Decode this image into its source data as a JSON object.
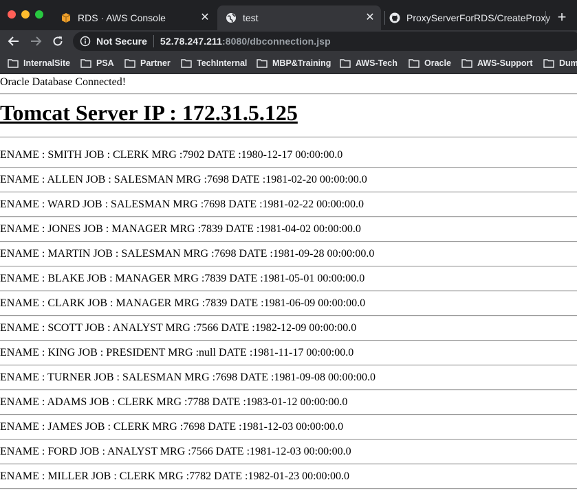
{
  "browser": {
    "tabs": [
      {
        "title": "RDS · AWS Console",
        "icon": "aws-box-icon",
        "active": false
      },
      {
        "title": "test",
        "icon": "globe-icon",
        "active": true
      },
      {
        "title": "ProxyServerForRDS/CreateProxy",
        "icon": "github-icon",
        "active": false
      }
    ],
    "security_label": "Not Secure",
    "url_host": "52.78.247.211",
    "url_rest": ":8080/dbconnection.jsp",
    "bookmarks": [
      "InternalSite",
      "PSA",
      "Partner",
      "TechInternal",
      "MBP&Training",
      "AWS-Tech",
      "Oracle",
      "AWS-Support",
      "Dum"
    ]
  },
  "page": {
    "status_text": "Oracle Database Connected!",
    "server_heading": "Tomcat Server IP : 172.31.5.125",
    "records": [
      "ENAME : SMITH JOB : CLERK MRG :7902 DATE :1980-12-17 00:00:00.0",
      "ENAME : ALLEN JOB : SALESMAN MRG :7698 DATE :1981-02-20 00:00:00.0",
      "ENAME : WARD JOB : SALESMAN MRG :7698 DATE :1981-02-22 00:00:00.0",
      "ENAME : JONES JOB : MANAGER MRG :7839 DATE :1981-04-02 00:00:00.0",
      "ENAME : MARTIN JOB : SALESMAN MRG :7698 DATE :1981-09-28 00:00:00.0",
      "ENAME : BLAKE JOB : MANAGER MRG :7839 DATE :1981-05-01 00:00:00.0",
      "ENAME : CLARK JOB : MANAGER MRG :7839 DATE :1981-06-09 00:00:00.0",
      "ENAME : SCOTT JOB : ANALYST MRG :7566 DATE :1982-12-09 00:00:00.0",
      "ENAME : KING JOB : PRESIDENT MRG :null DATE :1981-11-17 00:00:00.0",
      "ENAME : TURNER JOB : SALESMAN MRG :7698 DATE :1981-09-08 00:00:00.0",
      "ENAME : ADAMS JOB : CLERK MRG :7788 DATE :1983-01-12 00:00:00.0",
      "ENAME : JAMES JOB : CLERK MRG :7698 DATE :1981-12-03 00:00:00.0",
      "ENAME : FORD JOB : ANALYST MRG :7566 DATE :1981-12-03 00:00:00.0",
      "ENAME : MILLER JOB : CLERK MRG :7782 DATE :1982-01-23 00:00:00.0"
    ]
  }
}
